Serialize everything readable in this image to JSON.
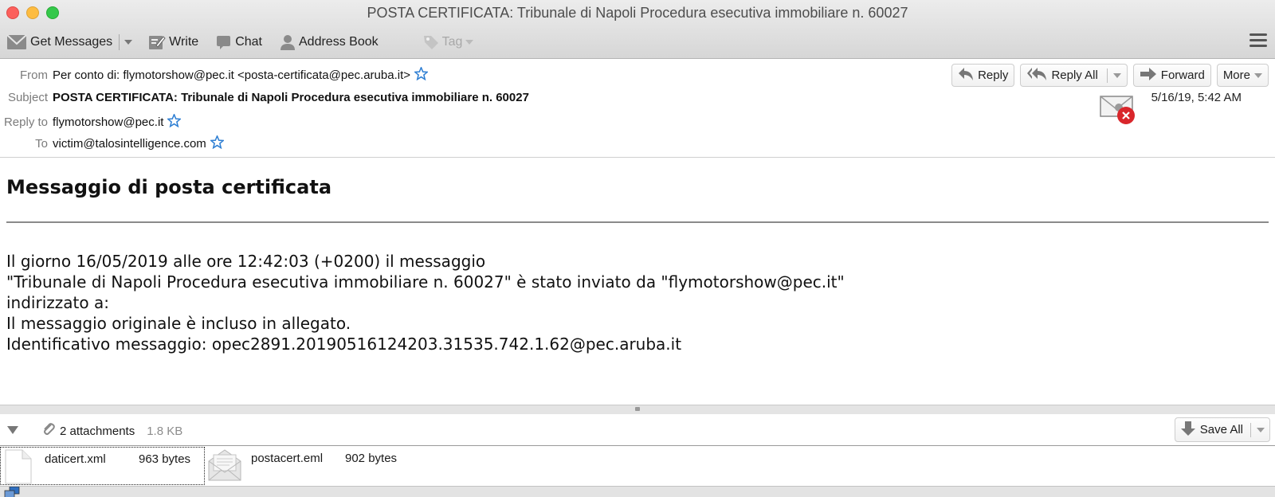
{
  "window": {
    "title": "POSTA CERTIFICATA: Tribunale di Napoli Procedura esecutiva immobiliare n. 60027"
  },
  "toolbar": {
    "get_messages": "Get Messages",
    "write": "Write",
    "chat": "Chat",
    "address_book": "Address Book",
    "tag": "Tag"
  },
  "header": {
    "fields": [
      {
        "label": "From",
        "value": "Per conto di: flymotorshow@pec.it <posta-certificata@pec.aruba.it>"
      },
      {
        "label": "Subject",
        "value": "POSTA CERTIFICATA: Tribunale di Napoli Procedura esecutiva immobiliare n. 60027"
      },
      {
        "label": "Reply to",
        "value": "flymotorshow@pec.it"
      },
      {
        "label": "To",
        "value": "victim@talosintelligence.com"
      }
    ],
    "buttons": {
      "reply": "Reply",
      "reply_all": "Reply All",
      "forward": "Forward",
      "more": "More"
    },
    "date": "5/16/19, 5:42 AM",
    "star_color": "#2f7fd3"
  },
  "body": {
    "title": "Messaggio di posta certificata",
    "lines": [
      "Il giorno 16/05/2019 alle ore 12:42:03 (+0200) il messaggio",
      "\"Tribunale di Napoli Procedura esecutiva immobiliare n. 60027\" è stato inviato da \"flymotorshow@pec.it\"",
      "indirizzato a:",
      "Il messaggio originale è incluso in allegato.",
      "Identificativo messaggio: opec2891.20190516124203.31535.742.1.62@pec.aruba.it"
    ]
  },
  "attachments": {
    "summary": "2 attachments",
    "total_size": "1.8 KB",
    "save_all": "Save All",
    "items": [
      {
        "name": "daticert.xml",
        "size": "963 bytes",
        "icon": "file-icon"
      },
      {
        "name": "postacert.eml",
        "size": "902 bytes",
        "icon": "open-envelope-icon"
      }
    ]
  }
}
